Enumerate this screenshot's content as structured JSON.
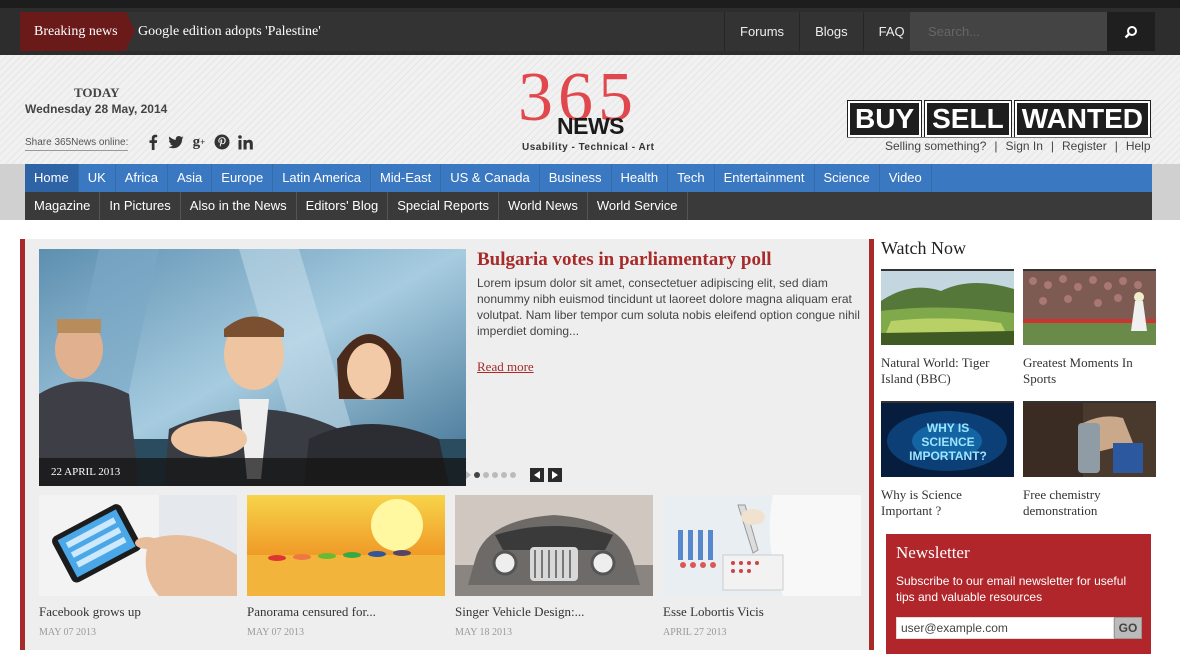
{
  "topbar": {
    "breaking_label": "Breaking news",
    "breaking_text": "Google edition adopts 'Palestine'",
    "links": [
      "Forums",
      "Blogs",
      "FAQ"
    ],
    "search_placeholder": "Search..."
  },
  "header": {
    "today_label": "TODAY",
    "date": "Wednesday 28 May, 2014",
    "share_label": "Share 365News online:",
    "social_icons": [
      "facebook-icon",
      "twitter-icon",
      "google-plus-icon",
      "pinterest-icon",
      "linkedin-icon"
    ],
    "logo_number": "365",
    "logo_word": "NEWS",
    "logo_tagline": "Usability - Technical - Art",
    "classifieds": [
      "BUY",
      "SELL",
      "WANTED"
    ],
    "account_links": [
      "Selling something?",
      "Sign In",
      "Register",
      "Help"
    ]
  },
  "nav": {
    "primary": [
      "Home",
      "UK",
      "Africa",
      "Asia",
      "Europe",
      "Latin America",
      "Mid-East",
      "US & Canada",
      "Business",
      "Health",
      "Tech",
      "Entertainment",
      "Science",
      "Video"
    ],
    "secondary": [
      "Magazine",
      "In Pictures",
      "Also in the News",
      "Editors' Blog",
      "Special Reports",
      "World News",
      "World Service"
    ]
  },
  "featured": {
    "title": "Bulgaria votes in parliamentary poll",
    "body": "Lorem ipsum dolor sit amet, consectetuer adipiscing elit, sed diam nonummy nibh euismod tincidunt ut laoreet dolore magna aliquam erat volutpat. Nam liber tempor cum soluta nobis eleifend option congue nihil imperdiet doming...",
    "read_more": "Read more",
    "date": "22 APRIL 2013",
    "slide_count": 5,
    "active_slide": 1
  },
  "articles": [
    {
      "title": "Facebook grows up",
      "date": "MAY 07 2013"
    },
    {
      "title": "Panorama censured for...",
      "date": "MAY 07 2013"
    },
    {
      "title": "Singer Vehicle Design:...",
      "date": "MAY 18 2013"
    },
    {
      "title": "Esse Lobortis Vicis",
      "date": "APRIL 27 2013"
    }
  ],
  "watch_now": {
    "title": "Watch Now",
    "videos": [
      {
        "title": "Natural World: Tiger Island (BBC)"
      },
      {
        "title": "Greatest Moments In Sports"
      },
      {
        "title": "Why is Science Important ?",
        "image_text": "WHY IS SCIENCE IMPORTANT?"
      },
      {
        "title": "Free chemistry demonstration"
      }
    ]
  },
  "newsletter": {
    "title": "Newsletter",
    "text": "Subscribe to our email newsletter for useful tips and valuable resources",
    "input_value": "user@example.com",
    "button": "GO"
  },
  "colors": {
    "accent_red": "#a82a2a",
    "logo_red": "#e0484e",
    "nav_blue": "#3a78c1",
    "nav_dark": "#3a3a3a",
    "topbar": "#2d2d2d"
  }
}
